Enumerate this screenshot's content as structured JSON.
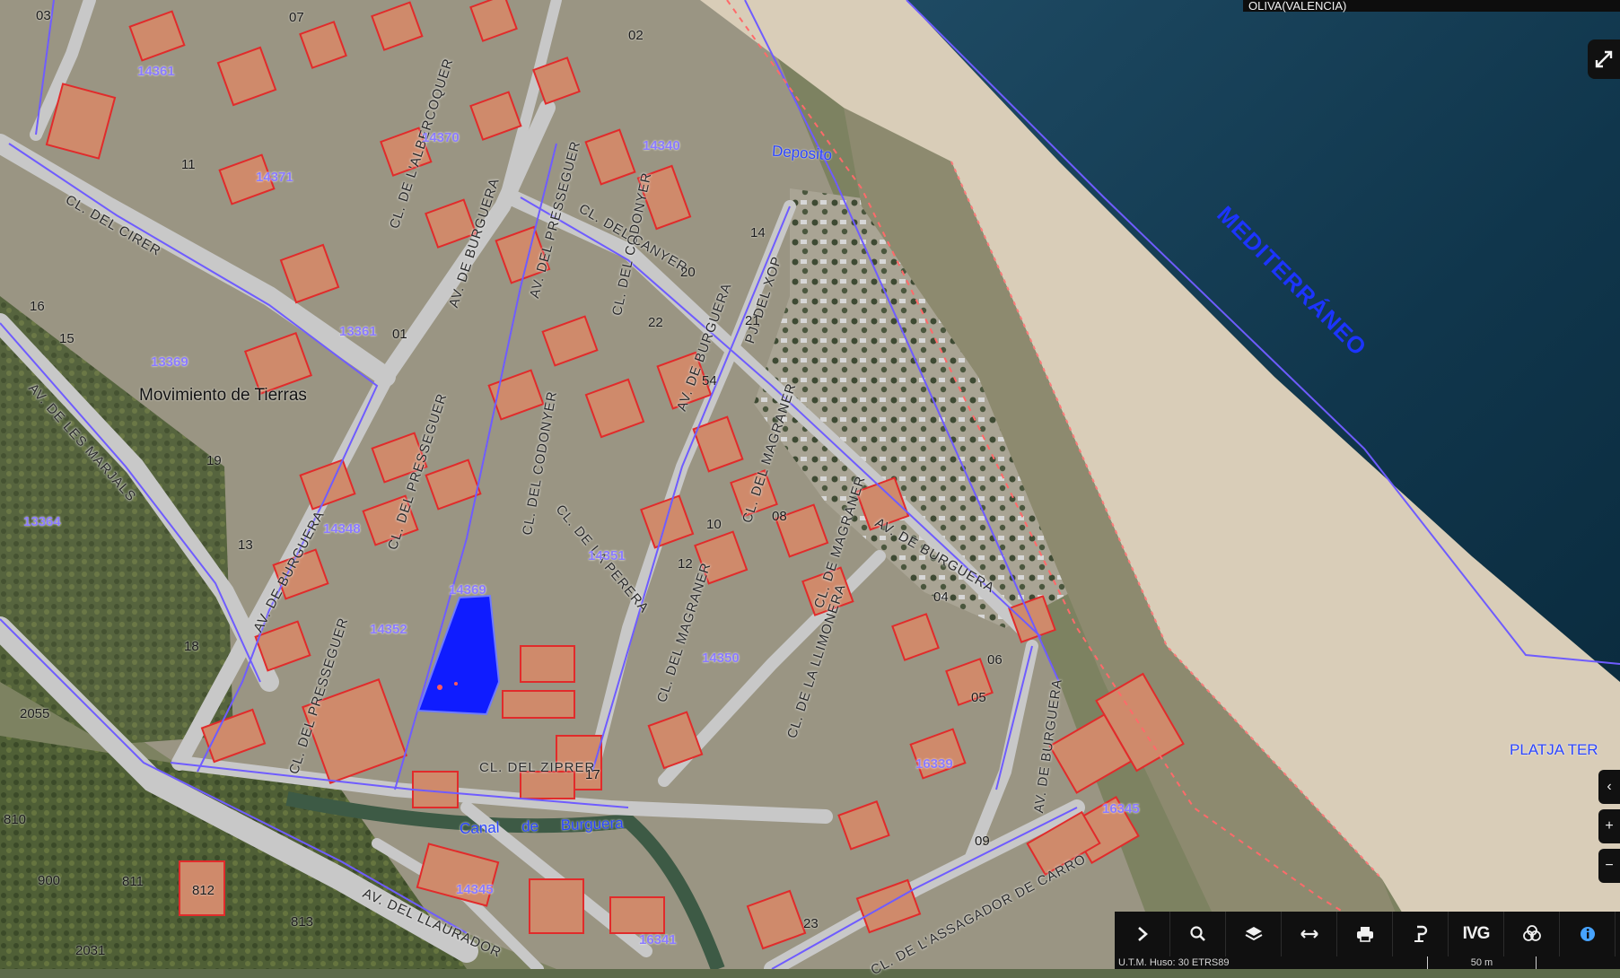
{
  "header": {
    "municipality": "OLIVA(VALENCIA)"
  },
  "labels": {
    "sea": "MEDITERRÁNEO",
    "deposito": "Deposito",
    "canal": "Canal de Burguera",
    "beach": "PLATJA TER",
    "movimiento": "Movimiento de Tierras",
    "cl_ziprer": "CL. DEL ZIPRER",
    "av_burguera_1": "AV. DE BURGUERA",
    "av_burguera_2": "AV. DE BURGUERA",
    "av_burguera_3": "AV. DE BURGUERA",
    "av_burguera_4": "AV. DE BURGUERA",
    "av_burguera_5": "AV. DE BURGUERA",
    "cl_magraner_1": "CL. DEL MAGRANER",
    "cl_magraner_2": "CL. DEL MAGRANER",
    "cl_magraner_3": "CL. DE MAGRANER",
    "cl_llimonera": "CL. DE LA LLIMONERA",
    "cl_assagador": "CL. DE L'ASSAGADOR DE CARRO",
    "av_llaurador": "AV. DEL LLAURADOR",
    "av_marjals": "AV. DE LES MARJALS",
    "cl_cirer": "CL. DEL CIRER",
    "cl_albercoquer": "CL. DE L'ALBERCOQUER",
    "cl_codonyer_1": "CL. DEL CODONYER",
    "cl_codonyer_2": "CL. DEL CODONYER",
    "cl_presseguer_1": "CL. DEL PRESSEGUER",
    "cl_presseguer_2": "CL. DEL PRESSEGUER",
    "cl_perera": "CL. DE LA PERERA",
    "cl_xop": "PJ. DEL XOP",
    "av_pressseguer": "AV. DEL PRESSEGUER",
    "cl_canyer": "CL. DEL CANYER"
  },
  "parcels": [
    "14352",
    "14351",
    "14350",
    "16341",
    "16345",
    "16339",
    "14340",
    "14370",
    "14371",
    "13369",
    "13361",
    "14345",
    "14348",
    "13364",
    "14361",
    "14369"
  ],
  "numbers": [
    "03",
    "02",
    "07",
    "05",
    "06",
    "04",
    "01",
    "09",
    "11",
    "13",
    "15",
    "16",
    "17",
    "19",
    "20",
    "21",
    "22",
    "23",
    "54",
    "08",
    "10",
    "12",
    "14",
    "18",
    "900",
    "811",
    "812",
    "813",
    "2031",
    "2055",
    "810"
  ],
  "toolbar": {
    "ivg_label": "IVG",
    "crs": "U.T.M. Huso: 30 ETRS89",
    "scale": "50 m"
  }
}
